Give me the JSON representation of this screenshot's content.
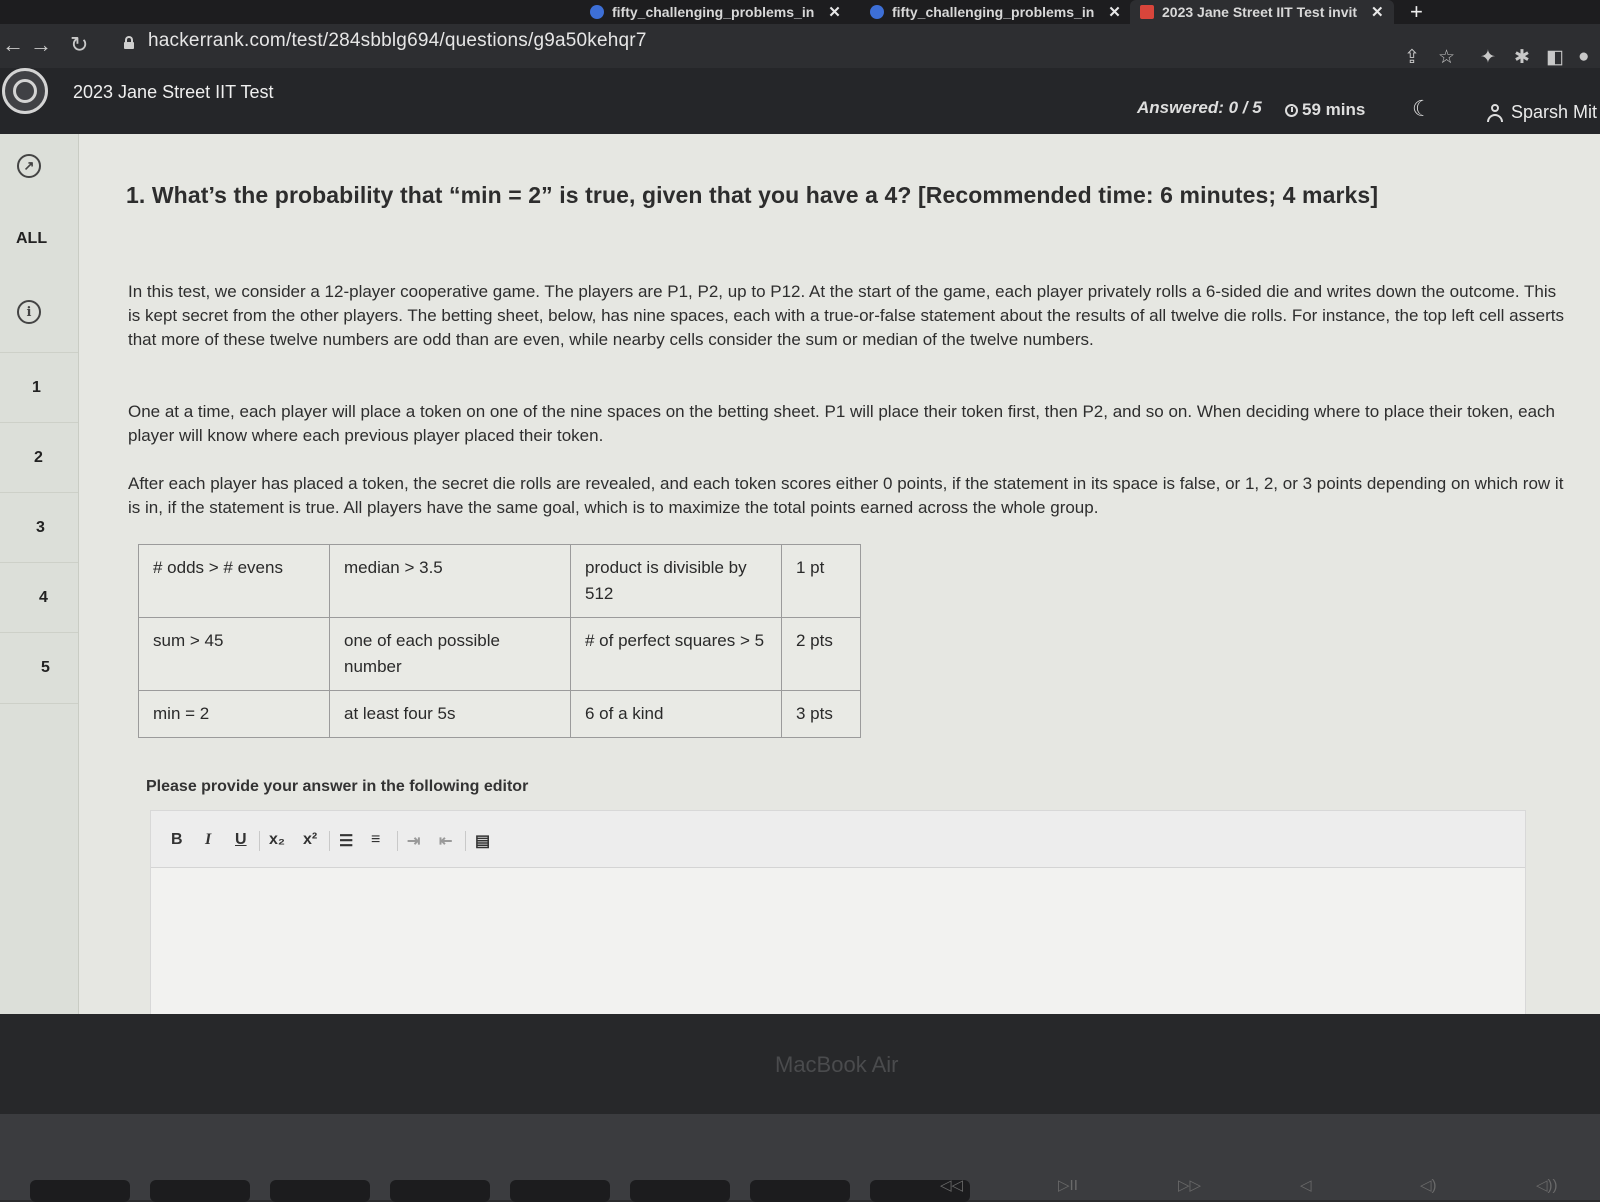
{
  "browser": {
    "tabs": [
      {
        "label": "fifty_challenging_problems_in"
      },
      {
        "label": "fifty_challenging_problems_in"
      },
      {
        "label": "2023 Jane Street IIT Test invit"
      }
    ],
    "url": "hackerrank.com/test/284sbblg694/questions/g9a50kehqr7"
  },
  "header": {
    "title": "2023 Jane Street IIT Test",
    "answered": "Answered: 0 / 5",
    "timer": "59 mins",
    "user": "Sparsh Mit"
  },
  "sidebar": {
    "all_label": "ALL",
    "questions": [
      "1",
      "2",
      "3",
      "4",
      "5"
    ]
  },
  "question": {
    "title": "1. What’s the probability that “min = 2” is true, given that you have a 4? [Recommended time: 6 minutes; 4 marks]",
    "paragraphs": [
      "In this test, we consider a 12-player cooperative game. The players are P1, P2, up to P12. At the start of the game, each player privately rolls a 6-sided die and writes down the outcome. This is kept secret from the other players. The betting sheet, below, has nine spaces, each with a true-or-false statement about the results of all twelve die rolls. For instance, the top left cell asserts that more of these twelve numbers are odd than are even, while nearby cells consider the sum or median of the twelve numbers.",
      "One at a time, each player will place a token on one of the nine spaces on the betting sheet. P1 will place their token first, then P2, and so on. When deciding where to place their token, each player will know where each previous player placed their token.",
      "After each player has placed a token, the secret die rolls are revealed, and each token scores either 0 points, if the statement in its space is false, or 1, 2, or 3 points depending on which row it is in, if the statement is true. All players have the same goal, which is to maximize the total points earned across the whole group."
    ],
    "betting_sheet": [
      [
        "# odds > # evens",
        "median > 3.5",
        "product is divisible by 512",
        "1 pt"
      ],
      [
        "sum > 45",
        "one of each possible number",
        "# of perfect squares > 5",
        "2 pts"
      ],
      [
        "min = 2",
        "at least four 5s",
        "6 of a kind",
        "3 pts"
      ]
    ]
  },
  "editor": {
    "prompt": "Please provide your answer in the following editor",
    "toolbar": {
      "bold": "B",
      "italic": "I",
      "underline": "U",
      "subscript": "x₂",
      "superscript": "x²"
    }
  },
  "device": {
    "label": "MacBook Air"
  }
}
